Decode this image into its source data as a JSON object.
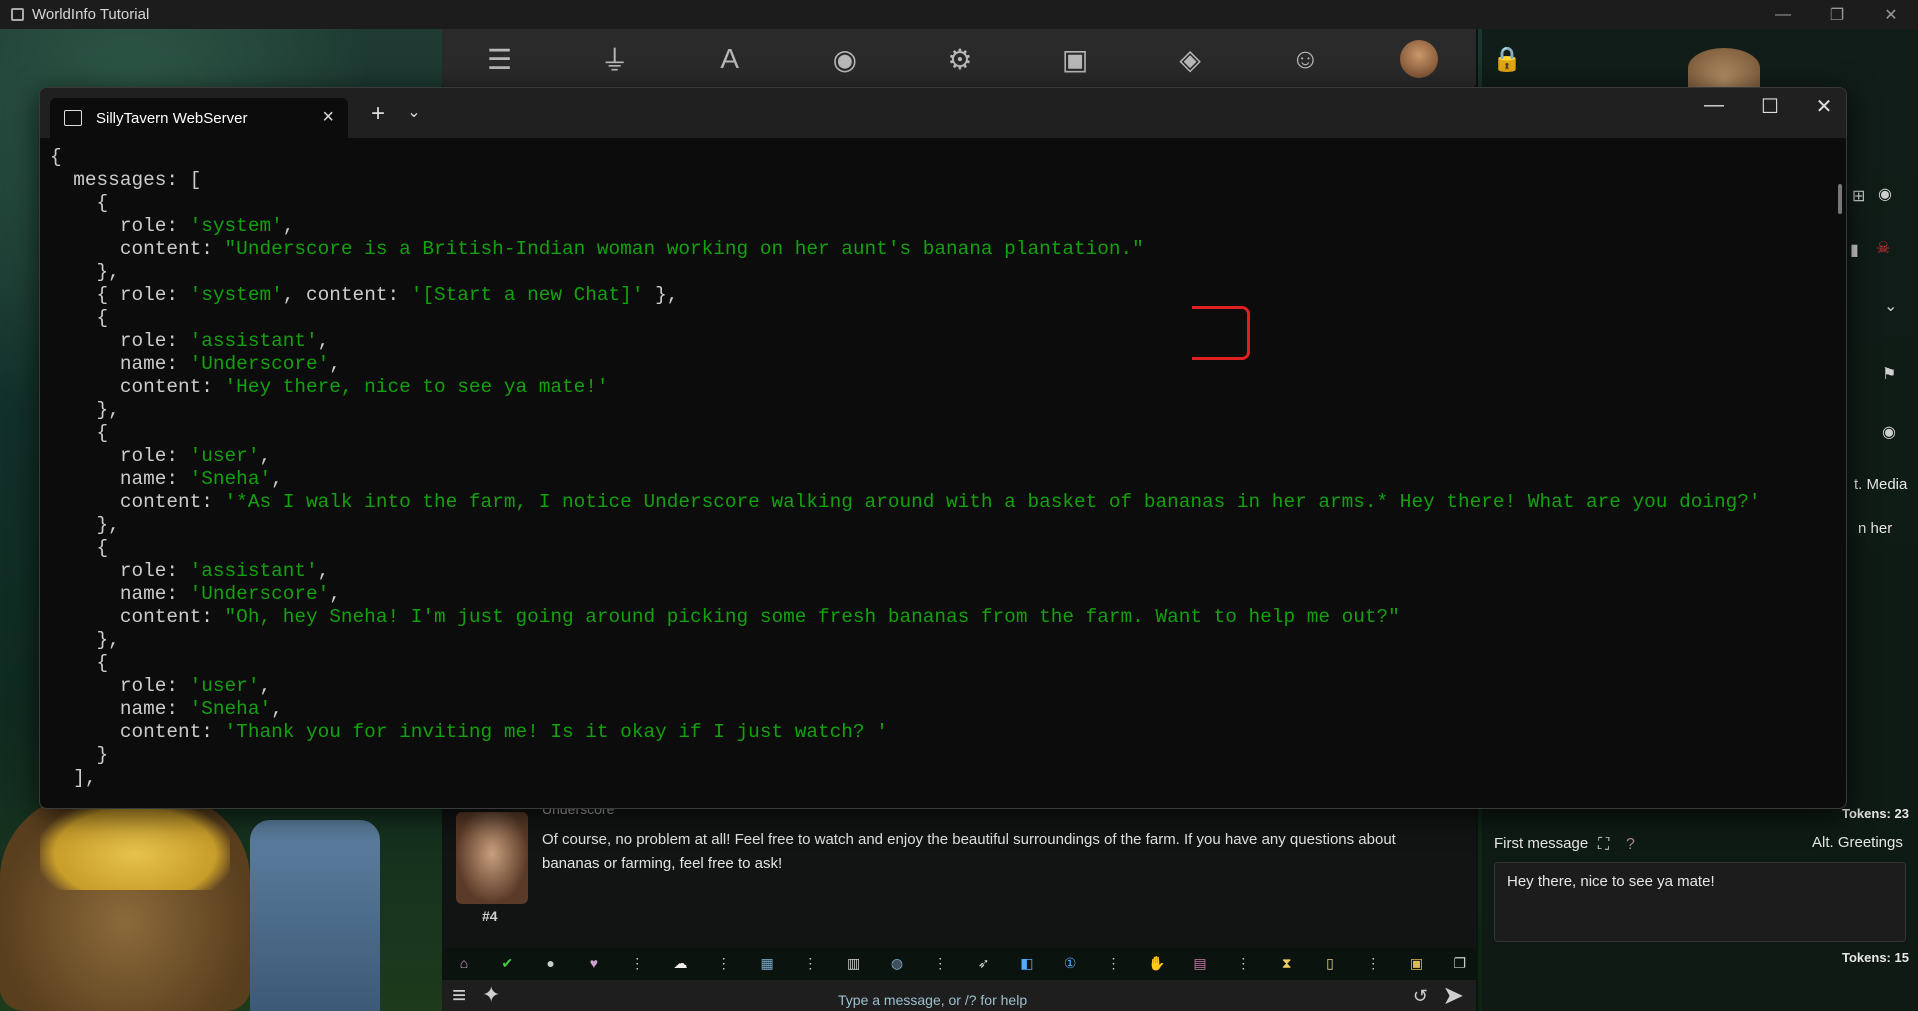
{
  "window": {
    "title": "WorldInfo Tutorial"
  },
  "outer_controls": {
    "minimize": "—",
    "restore": "❐",
    "close": "✕"
  },
  "st_topbar": {
    "icons": [
      "sliders-icon",
      "plug-icon",
      "font-icon",
      "book-icon",
      "user-gear-icon",
      "image-icon",
      "cubes-icon",
      "smile-icon"
    ]
  },
  "right_panel": {
    "alt_media": "t. Media",
    "peek_text": "n her",
    "tokens_top": "Tokens: 23",
    "first_message_label": "First message",
    "alt_greetings": "Alt. Greetings",
    "first_message_value": "Hey there, nice to see ya mate!",
    "tokens_bottom": "Tokens: 15"
  },
  "chat": {
    "name_peek": "Underscore",
    "message_text": "Of course, no problem at all! Feel free to watch and enjoy the beautiful surroundings of the farm. If you have any questions about bananas or farming, feel free to ask!",
    "message_index": "#4",
    "input_placeholder": "Type a message, or /? for help"
  },
  "terminal": {
    "tab_title": "SillyTavern WebServer",
    "new_tab": "+",
    "dropdown": "⌄",
    "controls": {
      "minimize": "—",
      "maximize": "☐",
      "close": "✕"
    },
    "lines": [
      [
        {
          "t": "{"
        }
      ],
      [
        {
          "t": "  messages: ["
        }
      ],
      [
        {
          "t": "    {"
        }
      ],
      [
        {
          "t": "      role: "
        },
        {
          "t": "'system'",
          "s": 1
        },
        {
          "t": ","
        }
      ],
      [
        {
          "t": "      content: "
        },
        {
          "t": "\"Underscore is a British-Indian woman working on her aunt's banana plantation.\"",
          "s": 1
        }
      ],
      [
        {
          "t": "    },"
        }
      ],
      [
        {
          "t": "    { role: "
        },
        {
          "t": "'system'",
          "s": 1
        },
        {
          "t": ", content: "
        },
        {
          "t": "'[Start a new Chat]'",
          "s": 1
        },
        {
          "t": " },"
        }
      ],
      [
        {
          "t": "    {"
        }
      ],
      [
        {
          "t": "      role: "
        },
        {
          "t": "'assistant'",
          "s": 1
        },
        {
          "t": ","
        }
      ],
      [
        {
          "t": "      name: "
        },
        {
          "t": "'Underscore'",
          "s": 1
        },
        {
          "t": ","
        }
      ],
      [
        {
          "t": "      content: "
        },
        {
          "t": "'Hey there, nice to see ya mate!'",
          "s": 1
        }
      ],
      [
        {
          "t": "    },"
        }
      ],
      [
        {
          "t": "    {"
        }
      ],
      [
        {
          "t": "      role: "
        },
        {
          "t": "'user'",
          "s": 1
        },
        {
          "t": ","
        }
      ],
      [
        {
          "t": "      name: "
        },
        {
          "t": "'Sneha'",
          "s": 1
        },
        {
          "t": ","
        }
      ],
      [
        {
          "t": "      content: "
        },
        {
          "t": "'*As I walk into the farm, I notice Underscore walking around with a basket of bananas in her arms.* Hey there! What are you doing?'",
          "s": 1
        }
      ],
      [
        {
          "t": "    },"
        }
      ],
      [
        {
          "t": "    {"
        }
      ],
      [
        {
          "t": "      role: "
        },
        {
          "t": "'assistant'",
          "s": 1
        },
        {
          "t": ","
        }
      ],
      [
        {
          "t": "      name: "
        },
        {
          "t": "'Underscore'",
          "s": 1
        },
        {
          "t": ","
        }
      ],
      [
        {
          "t": "      content: "
        },
        {
          "t": "\"Oh, hey Sneha! I'm just going around picking some fresh bananas from the farm. Want to help me out?\"",
          "s": 1
        }
      ],
      [
        {
          "t": "    },"
        }
      ],
      [
        {
          "t": "    {"
        }
      ],
      [
        {
          "t": "      role: "
        },
        {
          "t": "'user'",
          "s": 1
        },
        {
          "t": ","
        }
      ],
      [
        {
          "t": "      name: "
        },
        {
          "t": "'Sneha'",
          "s": 1
        },
        {
          "t": ","
        }
      ],
      [
        {
          "t": "      content: "
        },
        {
          "t": "'Thank you for inviting me! Is it okay if I just watch? '",
          "s": 1
        }
      ],
      [
        {
          "t": "    }"
        }
      ],
      [
        {
          "t": "  ],"
        }
      ]
    ]
  },
  "colors": {
    "terminal_bg": "#0c0c0c",
    "string": "#13a10e",
    "text": "#cccccc",
    "annotation": "#e02020"
  }
}
